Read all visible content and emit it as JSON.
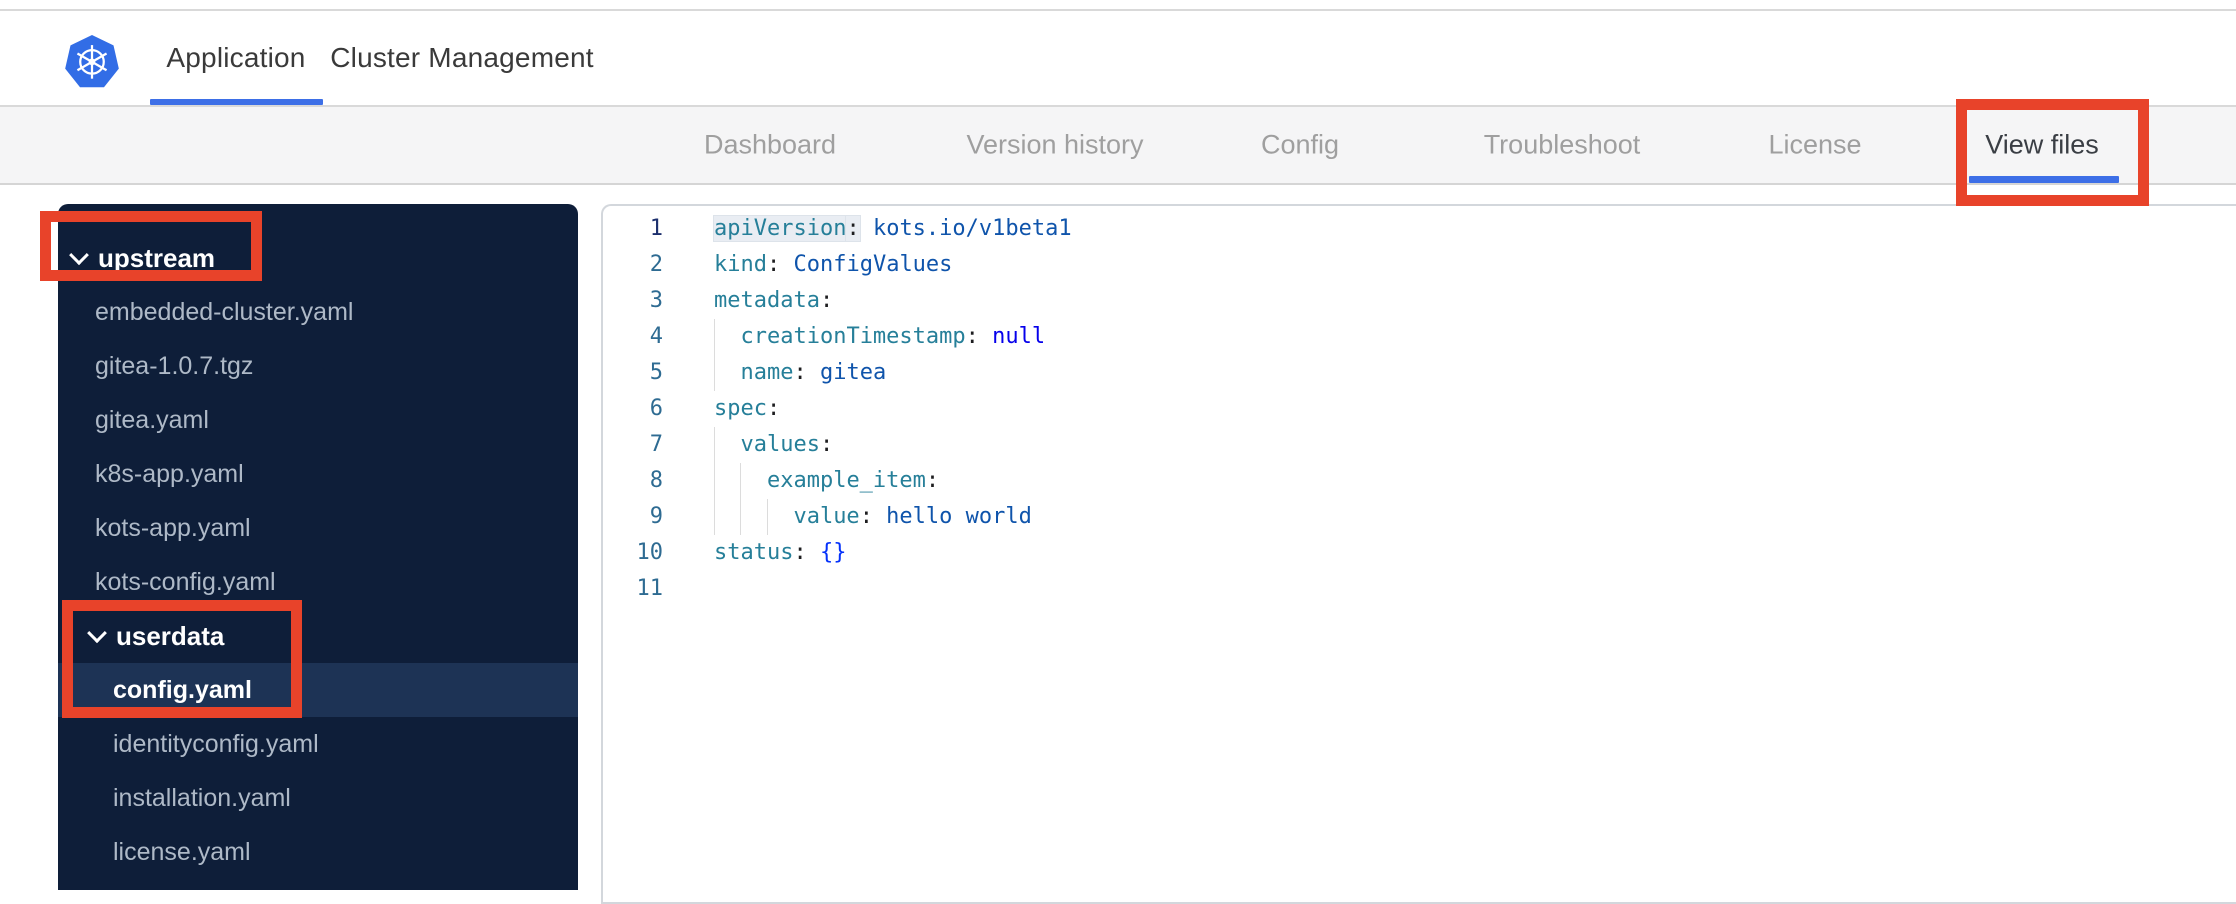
{
  "topbar": {
    "logo_icon": "kubernetes-logo",
    "tabs": [
      {
        "label": "Application",
        "active": true
      },
      {
        "label": "Cluster Management",
        "active": false
      }
    ],
    "accent_color": "#3d6fe7"
  },
  "navbar": {
    "tabs": [
      {
        "label": "Dashboard",
        "active": false
      },
      {
        "label": "Version history",
        "active": false
      },
      {
        "label": "Config",
        "active": false
      },
      {
        "label": "Troubleshoot",
        "active": false
      },
      {
        "label": "License",
        "active": false
      },
      {
        "label": "View files",
        "active": true
      }
    ]
  },
  "sidebar": {
    "background_color": "#0e1e39",
    "selected_row_color": "#1d3355",
    "items": [
      {
        "label": "upstream",
        "type": "folder",
        "level": 0,
        "expanded": true,
        "selected": false
      },
      {
        "label": "embedded-cluster.yaml",
        "type": "file",
        "level": 1,
        "selected": false
      },
      {
        "label": "gitea-1.0.7.tgz",
        "type": "file",
        "level": 1,
        "selected": false
      },
      {
        "label": "gitea.yaml",
        "type": "file",
        "level": 1,
        "selected": false
      },
      {
        "label": "k8s-app.yaml",
        "type": "file",
        "level": 1,
        "selected": false
      },
      {
        "label": "kots-app.yaml",
        "type": "file",
        "level": 1,
        "selected": false
      },
      {
        "label": "kots-config.yaml",
        "type": "file",
        "level": 1,
        "selected": false
      },
      {
        "label": "userdata",
        "type": "folder",
        "level": 1,
        "expanded": true,
        "selected": false
      },
      {
        "label": "config.yaml",
        "type": "file",
        "level": 2,
        "selected": true
      },
      {
        "label": "identityconfig.yaml",
        "type": "file",
        "level": 2,
        "selected": false
      },
      {
        "label": "installation.yaml",
        "type": "file",
        "level": 2,
        "selected": false
      },
      {
        "label": "license.yaml",
        "type": "file",
        "level": 2,
        "selected": false
      }
    ]
  },
  "editor": {
    "language": "yaml",
    "colors": {
      "key": "#267f99",
      "string": "#0f54ab",
      "keyword": "#0600eb",
      "brace": "#0431fa",
      "line_number": "#2e6b92",
      "active_line_number": "#1c2f6d"
    },
    "lines": [
      {
        "num": "1",
        "active": true,
        "tokens": [
          {
            "t": "key",
            "s": "apiVersion",
            "hl": true
          },
          {
            "t": "colon",
            "s": ":",
            "hl": true
          },
          {
            "t": "str",
            "s": " kots.io/v1beta1"
          }
        ]
      },
      {
        "num": "2",
        "active": false,
        "tokens": [
          {
            "t": "key",
            "s": "kind"
          },
          {
            "t": "colon",
            "s": ":"
          },
          {
            "t": "str",
            "s": " ConfigValues"
          }
        ]
      },
      {
        "num": "3",
        "active": false,
        "tokens": [
          {
            "t": "key",
            "s": "metadata"
          },
          {
            "t": "colon",
            "s": ":"
          }
        ]
      },
      {
        "num": "4",
        "active": false,
        "tokens": [
          {
            "t": "guide",
            "s": "  "
          },
          {
            "t": "key",
            "s": "creationTimestamp"
          },
          {
            "t": "colon",
            "s": ":"
          },
          {
            "t": "kw",
            "s": " null"
          }
        ]
      },
      {
        "num": "5",
        "active": false,
        "tokens": [
          {
            "t": "guide",
            "s": "  "
          },
          {
            "t": "key",
            "s": "name"
          },
          {
            "t": "colon",
            "s": ":"
          },
          {
            "t": "str",
            "s": " gitea"
          }
        ]
      },
      {
        "num": "6",
        "active": false,
        "tokens": [
          {
            "t": "key",
            "s": "spec"
          },
          {
            "t": "colon",
            "s": ":"
          }
        ]
      },
      {
        "num": "7",
        "active": false,
        "tokens": [
          {
            "t": "guide",
            "s": "  "
          },
          {
            "t": "key",
            "s": "values"
          },
          {
            "t": "colon",
            "s": ":"
          }
        ]
      },
      {
        "num": "8",
        "active": false,
        "tokens": [
          {
            "t": "guide",
            "s": "  "
          },
          {
            "t": "guide",
            "s": "  "
          },
          {
            "t": "key",
            "s": "example_item"
          },
          {
            "t": "colon",
            "s": ":"
          }
        ]
      },
      {
        "num": "9",
        "active": false,
        "tokens": [
          {
            "t": "guide",
            "s": "  "
          },
          {
            "t": "guide",
            "s": "  "
          },
          {
            "t": "guide",
            "s": "  "
          },
          {
            "t": "key",
            "s": "value"
          },
          {
            "t": "colon",
            "s": ":"
          },
          {
            "t": "str",
            "s": " hello world"
          }
        ]
      },
      {
        "num": "10",
        "active": false,
        "tokens": [
          {
            "t": "key",
            "s": "status"
          },
          {
            "t": "colon",
            "s": ":"
          },
          {
            "t": "brace",
            "s": " {}"
          }
        ]
      },
      {
        "num": "11",
        "active": false,
        "tokens": []
      }
    ]
  },
  "annotations": {
    "color": "#e8432a",
    "boxes": [
      "upstream-folder",
      "userdata-folder-and-config-yaml",
      "view-files-tab"
    ]
  }
}
